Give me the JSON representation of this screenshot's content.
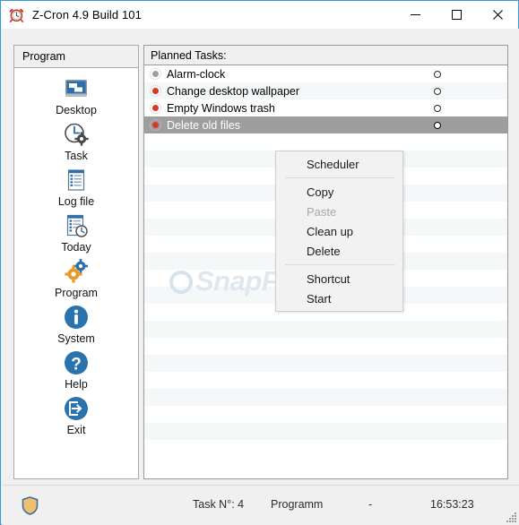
{
  "window": {
    "title": "Z-Cron 4.9 Build 101",
    "icon": "alarm-clock-icon",
    "minimize_label": "─",
    "maximize_label": "☐",
    "close_label": "✕",
    "border_color": "#3a9ad9"
  },
  "sidebar": {
    "tab_label": "Program",
    "items": [
      {
        "label": "Desktop",
        "icon": "monitor-icon"
      },
      {
        "label": "Task",
        "icon": "clock-gear-icon"
      },
      {
        "label": "Log file",
        "icon": "document-list-icon"
      },
      {
        "label": "Today",
        "icon": "document-clock-icon"
      },
      {
        "label": "Program",
        "icon": "gears-icon"
      },
      {
        "label": "System",
        "icon": "info-icon"
      },
      {
        "label": "Help",
        "icon": "question-icon"
      },
      {
        "label": "Exit",
        "icon": "exit-icon"
      }
    ]
  },
  "tasks": {
    "header": "Planned Tasks:",
    "rows": [
      {
        "label": "Alarm-clock",
        "status_color": "#9e9e9e",
        "selected": false
      },
      {
        "label": "Change desktop wallpaper",
        "status_color": "#d63b22",
        "selected": false
      },
      {
        "label": "Empty Windows trash",
        "status_color": "#d63b22",
        "selected": false
      },
      {
        "label": "Delete old files",
        "status_color": "#d63b22",
        "selected": true
      }
    ]
  },
  "context_menu": {
    "items": [
      {
        "label": "Scheduler",
        "disabled": false,
        "separator_after": true
      },
      {
        "label": "Copy",
        "disabled": false,
        "separator_after": false
      },
      {
        "label": "Paste",
        "disabled": true,
        "separator_after": false
      },
      {
        "label": "Clean up",
        "disabled": false,
        "separator_after": false
      },
      {
        "label": "Delete",
        "disabled": false,
        "separator_after": true
      },
      {
        "label": "Shortcut",
        "disabled": false,
        "separator_after": false
      },
      {
        "label": "Start",
        "disabled": false,
        "separator_after": false
      }
    ]
  },
  "watermark": {
    "text": "SnapFiles"
  },
  "statusbar": {
    "task_count": "Task N°: 4",
    "mode": "Programm",
    "detail": "-",
    "time": "16:53:23",
    "shield_icon": "shield-icon"
  }
}
